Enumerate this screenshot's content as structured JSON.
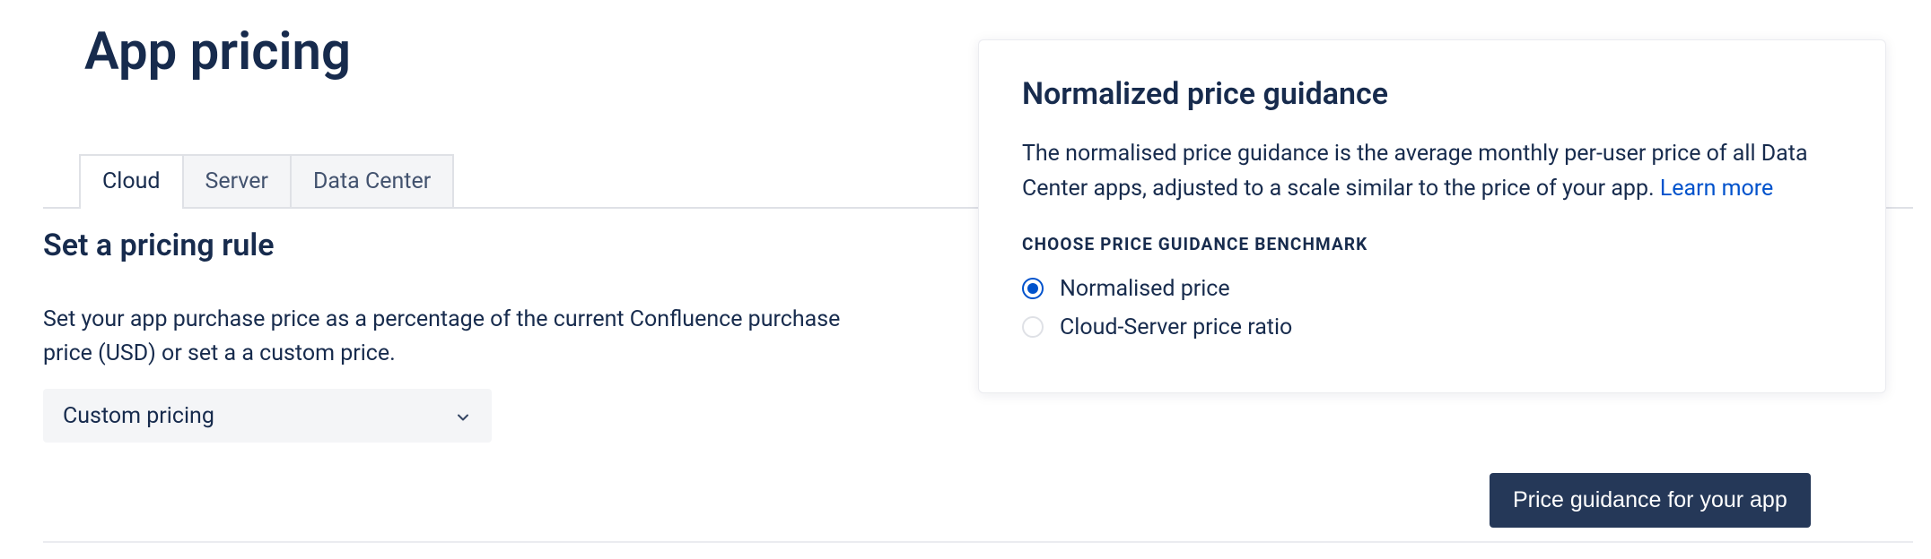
{
  "header": {
    "title": "App pricing"
  },
  "tabs": [
    {
      "label": "Cloud",
      "active": true
    },
    {
      "label": "Server",
      "active": false
    },
    {
      "label": "Data Center",
      "active": false
    }
  ],
  "rule_section": {
    "heading": "Set a pricing rule",
    "description": "Set your app purchase price as a percentage of the current Confluence purchase price (USD) or set a a custom price.",
    "select_value": "Custom pricing"
  },
  "panel": {
    "title": "Normalized price guidance",
    "description_pre": "The normalised price guidance is the average monthly per-user price of all Data Center apps, adjusted to a scale similar to the price of your app. ",
    "learn_more": "Learn more",
    "subheading": "CHOOSE PRICE GUIDANCE BENCHMARK",
    "options": {
      "opt0": "Normalised price",
      "opt1": "Cloud-Server price ratio"
    },
    "selected": "opt0"
  },
  "guidance_button": "Price guidance for your app"
}
